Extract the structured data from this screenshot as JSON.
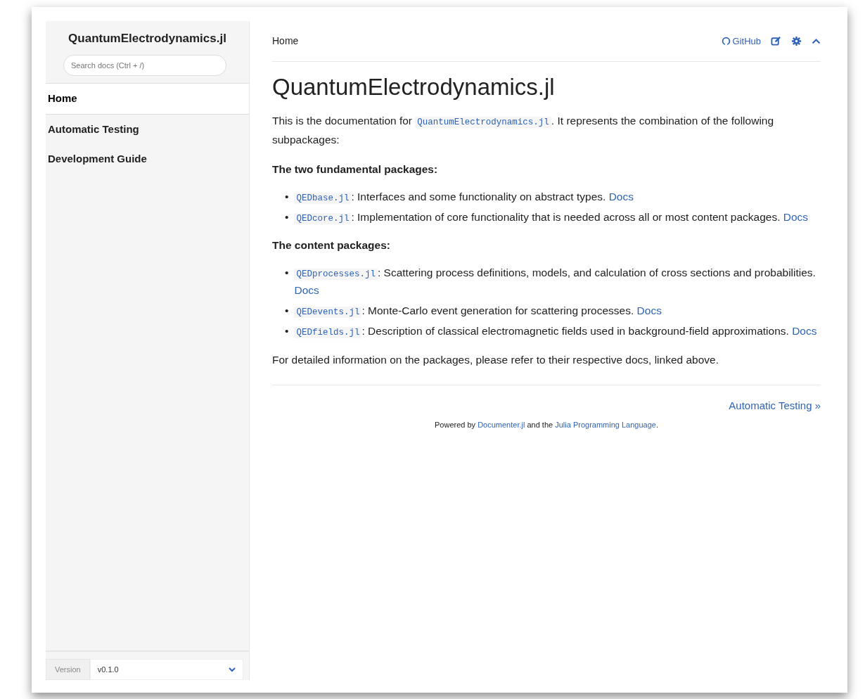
{
  "sidebar": {
    "title": "QuantumElectrodynamics.jl",
    "search": {
      "placeholder": "Search docs (Ctrl + /)"
    },
    "items": [
      {
        "label": "Home",
        "selected": true
      },
      {
        "label": "Automatic Testing",
        "selected": false
      },
      {
        "label": "Development Guide",
        "selected": false
      }
    ],
    "version": {
      "label": "Version",
      "value": "v0.1.0"
    }
  },
  "topbar": {
    "breadcrumb": "Home",
    "github": "GitHub"
  },
  "article": {
    "title": "QuantumElectrodynamics.jl",
    "blocks": [
      {
        "kind": "paragraph",
        "segments": [
          {
            "kind": "text",
            "text": "This is the documentation for "
          },
          {
            "kind": "code-link",
            "text": "QuantumElectrodynamics.jl"
          },
          {
            "kind": "text",
            "text": ". It represents the combination of the following subpackages:"
          }
        ]
      },
      {
        "kind": "lead",
        "segments": [
          {
            "kind": "text",
            "text": "The two fundamental packages:"
          }
        ]
      },
      {
        "kind": "list",
        "marker": "•",
        "items": [
          [
            {
              "kind": "code-link",
              "text": "QEDbase.jl"
            },
            {
              "kind": "text",
              "text": ": Interfaces and some functionality on abstract types. "
            },
            {
              "kind": "link",
              "text": "Docs"
            }
          ],
          [
            {
              "kind": "code-link",
              "text": "QEDcore.jl"
            },
            {
              "kind": "text",
              "text": ": Implementation of core functionality that is needed across all or most content packages. "
            },
            {
              "kind": "link",
              "text": "Docs"
            }
          ]
        ]
      },
      {
        "kind": "lead",
        "segments": [
          {
            "kind": "text",
            "text": "The content packages:"
          }
        ]
      },
      {
        "kind": "list",
        "marker": "•",
        "items": [
          [
            {
              "kind": "code-link",
              "text": "QEDprocesses.jl"
            },
            {
              "kind": "text",
              "text": ": Scattering process definitions, models, and calculation of cross sections and probabilities. "
            },
            {
              "kind": "link",
              "text": "Docs"
            }
          ],
          [
            {
              "kind": "code-link",
              "text": "QEDevents.jl"
            },
            {
              "kind": "text",
              "text": ": Monte-Carlo event generation for scattering processes. "
            },
            {
              "kind": "link",
              "text": "Docs"
            }
          ],
          [
            {
              "kind": "code-link",
              "text": "QEDfields.jl"
            },
            {
              "kind": "text",
              "text": ": Description of classical electromagnetic fields used in background-field approximations. "
            },
            {
              "kind": "link",
              "text": "Docs"
            }
          ]
        ]
      },
      {
        "kind": "paragraph",
        "segments": [
          {
            "kind": "text",
            "text": "For detailed information on the packages, please refer to their respective docs, linked above."
          }
        ]
      }
    ]
  },
  "footer": {
    "next": "Automatic Testing »",
    "powered": [
      {
        "kind": "text",
        "text": "Powered by "
      },
      {
        "kind": "link",
        "text": "Documenter.jl"
      },
      {
        "kind": "text",
        "text": " and the "
      },
      {
        "kind": "link",
        "text": "Julia Programming Language"
      },
      {
        "kind": "text",
        "text": "."
      }
    ]
  }
}
